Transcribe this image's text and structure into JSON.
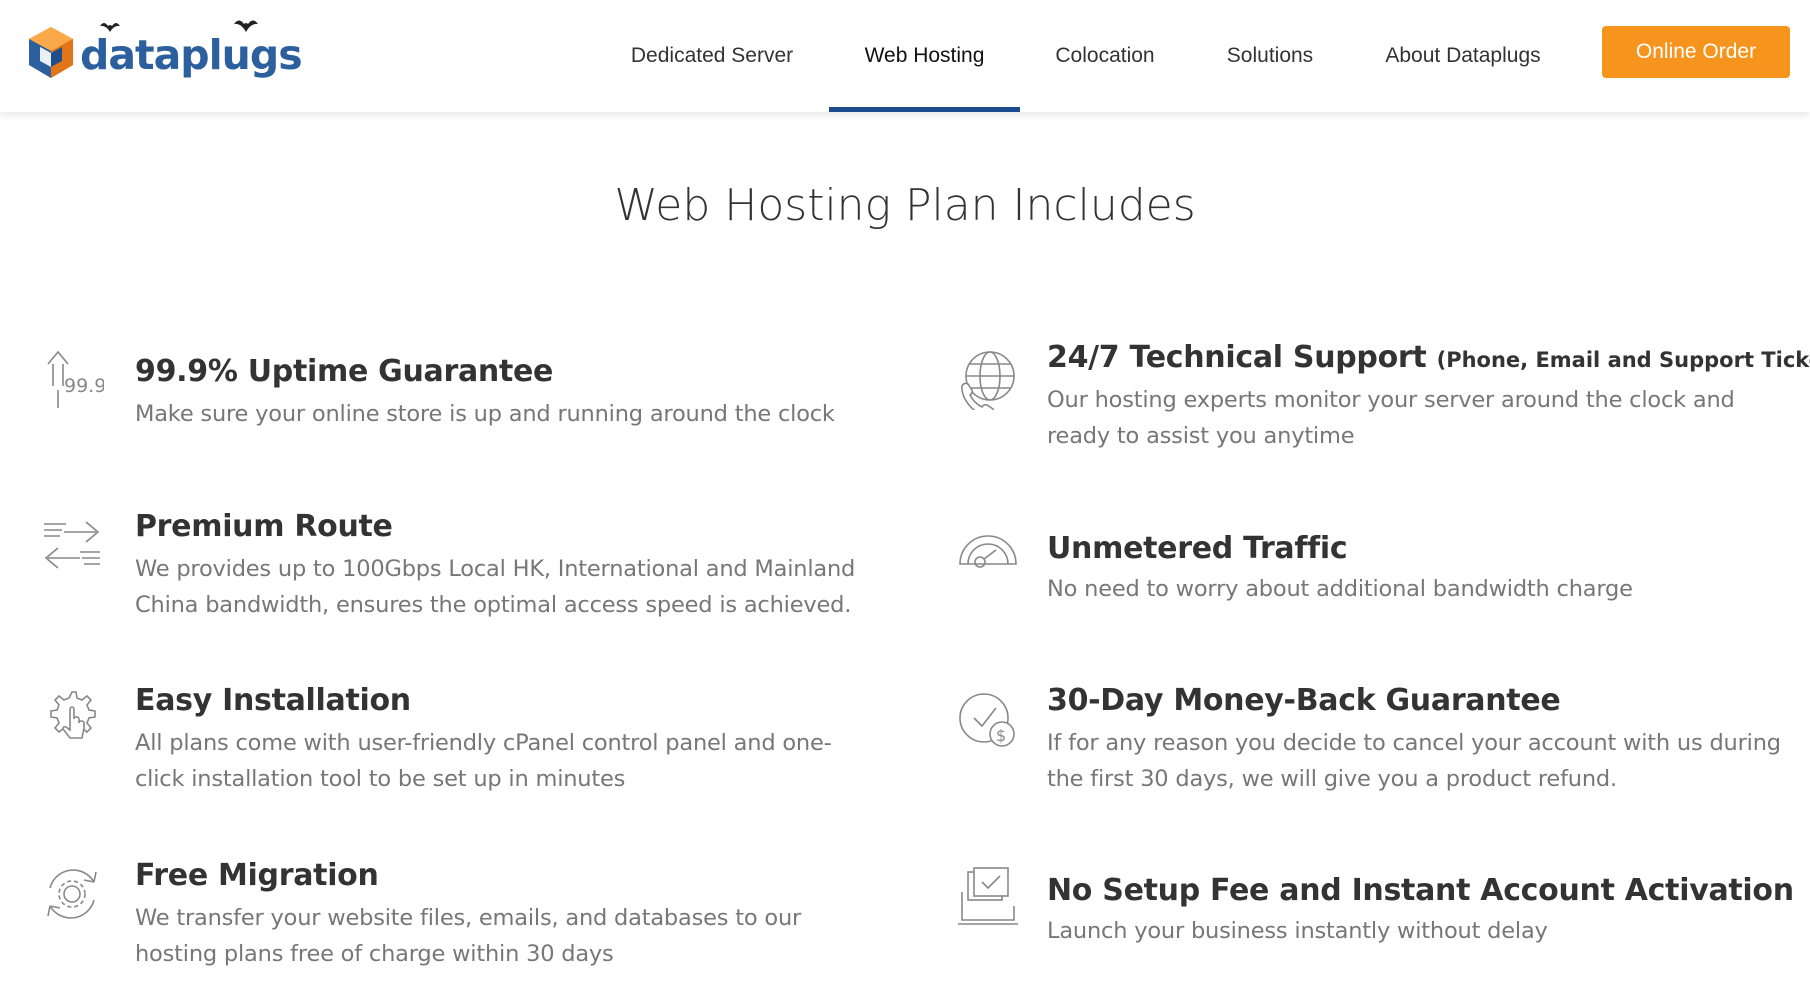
{
  "brand": {
    "name": "dataplugs",
    "colors": {
      "blue": "#2b5f9e",
      "orange": "#f7941d",
      "nav_underline": "#1b4b8c"
    }
  },
  "nav": {
    "items": [
      {
        "label": "Dedicated Server",
        "active": false
      },
      {
        "label": "Web Hosting",
        "active": true
      },
      {
        "label": "Colocation",
        "active": false
      },
      {
        "label": "Solutions",
        "active": false
      },
      {
        "label": "About Dataplugs",
        "active": false
      }
    ],
    "order_button": "Online Order"
  },
  "section": {
    "title": "Web Hosting Plan Includes"
  },
  "features": [
    {
      "icon": "uptime-arrow-icon",
      "icon_text": "99.9",
      "title": "99.9% Uptime Guarantee",
      "title_note": "",
      "desc": "Make sure your online store is up and running around the clock"
    },
    {
      "icon": "globe-phone-icon",
      "title": "24/7 Technical Support",
      "title_note": "(Phone, Email and Support Ticket)",
      "desc": "Our hosting experts monitor your server around the clock and ready to assist you anytime"
    },
    {
      "icon": "route-arrows-icon",
      "title": "Premium Route",
      "title_note": "",
      "desc": "We provides up to 100Gbps Local HK, International and Mainland China bandwidth, ensures the optimal access speed is achieved."
    },
    {
      "icon": "speedometer-icon",
      "title": "Unmetered Traffic",
      "title_note": "",
      "desc": "No need to worry about additional bandwidth charge"
    },
    {
      "icon": "gear-hand-icon",
      "title": "Easy Installation",
      "title_note": "",
      "desc": "All plans come with user-friendly cPanel control panel and one-click installation tool to be set up in minutes"
    },
    {
      "icon": "clock-dollar-icon",
      "title": "30-Day Money-Back Guarantee",
      "title_note": "",
      "desc": "If for any reason you decide to cancel your account with us during the first 30 days, we will give you a product refund."
    },
    {
      "icon": "migration-gear-icon",
      "title": "Free Migration",
      "title_note": "",
      "desc": "We transfer your website files, emails, and databases to our hosting plans free of charge within 30 days"
    },
    {
      "icon": "laptop-check-icon",
      "title": "No Setup Fee and Instant Account Activation",
      "title_note": "",
      "desc": "Launch your business instantly without delay"
    }
  ]
}
